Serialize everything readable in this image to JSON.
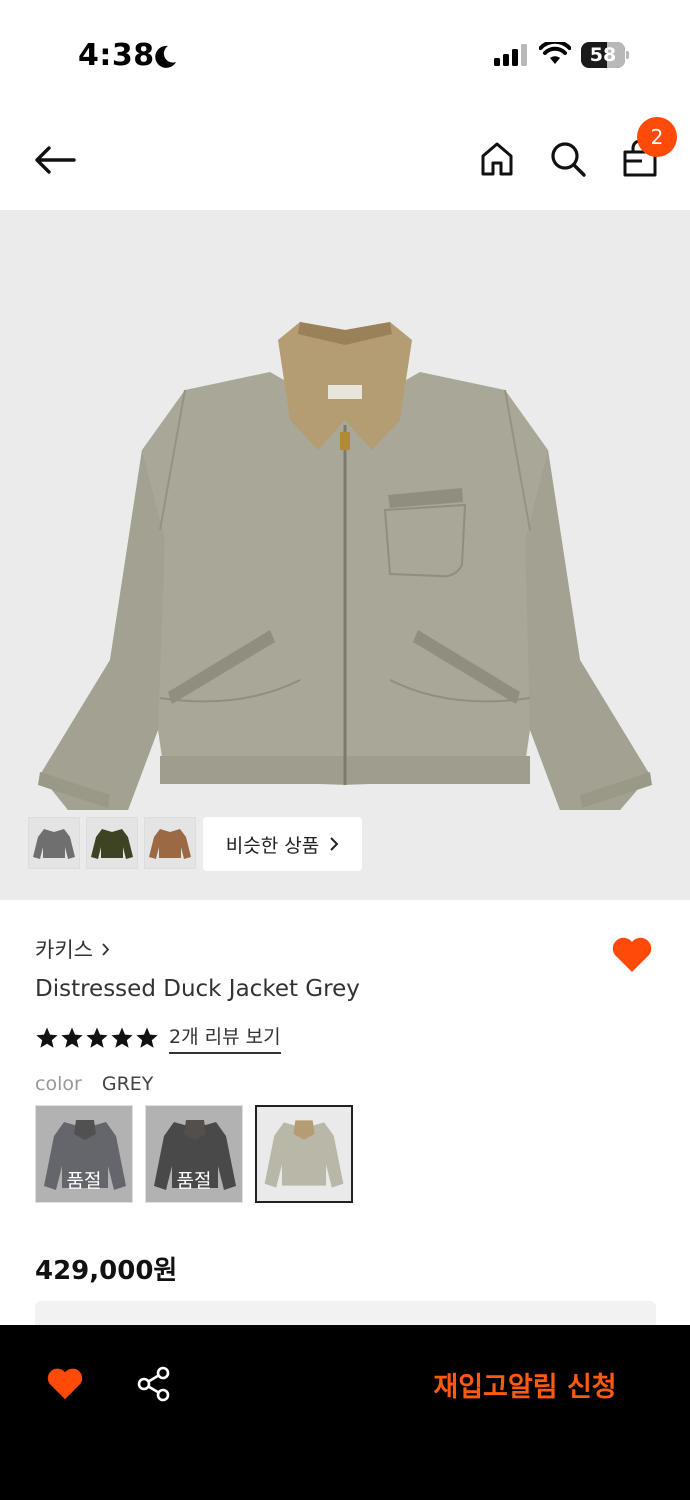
{
  "status_bar": {
    "time": "4:38",
    "battery": "58",
    "battery_level": 0.58,
    "icons": [
      "moon-icon",
      "signal-icon",
      "wifi-icon",
      "battery-icon"
    ]
  },
  "header": {
    "icons": [
      "back-arrow-icon",
      "home-icon",
      "search-icon",
      "shopping-bag-icon"
    ],
    "cart_count": "2"
  },
  "gallery": {
    "thumbnails": [
      {
        "icon": "jacket-thumbnail-grey",
        "color": "#6f6f6f"
      },
      {
        "icon": "jacket-thumbnail-olive",
        "color": "#3e4324"
      },
      {
        "icon": "jacket-thumbnail-brown",
        "color": "#9b6a44"
      }
    ],
    "similar_label": "비슷한 상품"
  },
  "product": {
    "brand": "카키스",
    "name": "Distressed Duck Jacket Grey",
    "rating_stars": 5,
    "review_link": "2개 리뷰 보기",
    "color_label": "color",
    "color_value": "GREY",
    "swatches": [
      {
        "name": "swatch-charcoal",
        "color": "#5b6068",
        "sold_out": true,
        "sold_out_label": "품절"
      },
      {
        "name": "swatch-black",
        "color": "#2a2a2a",
        "sold_out": true,
        "sold_out_label": "품절"
      },
      {
        "name": "swatch-grey",
        "color": "#b9b7a8",
        "sold_out": false
      }
    ],
    "price": "429,000원"
  },
  "bottom_bar": {
    "icons": [
      "heart-icon",
      "share-icon"
    ],
    "restock_label": "재입고알림 신청"
  },
  "colors": {
    "accent": "#ff4a0a",
    "restock_text": "#ff5a10",
    "bottom_bar_bg": "#000000",
    "hero_bg": "#ebebeb"
  }
}
